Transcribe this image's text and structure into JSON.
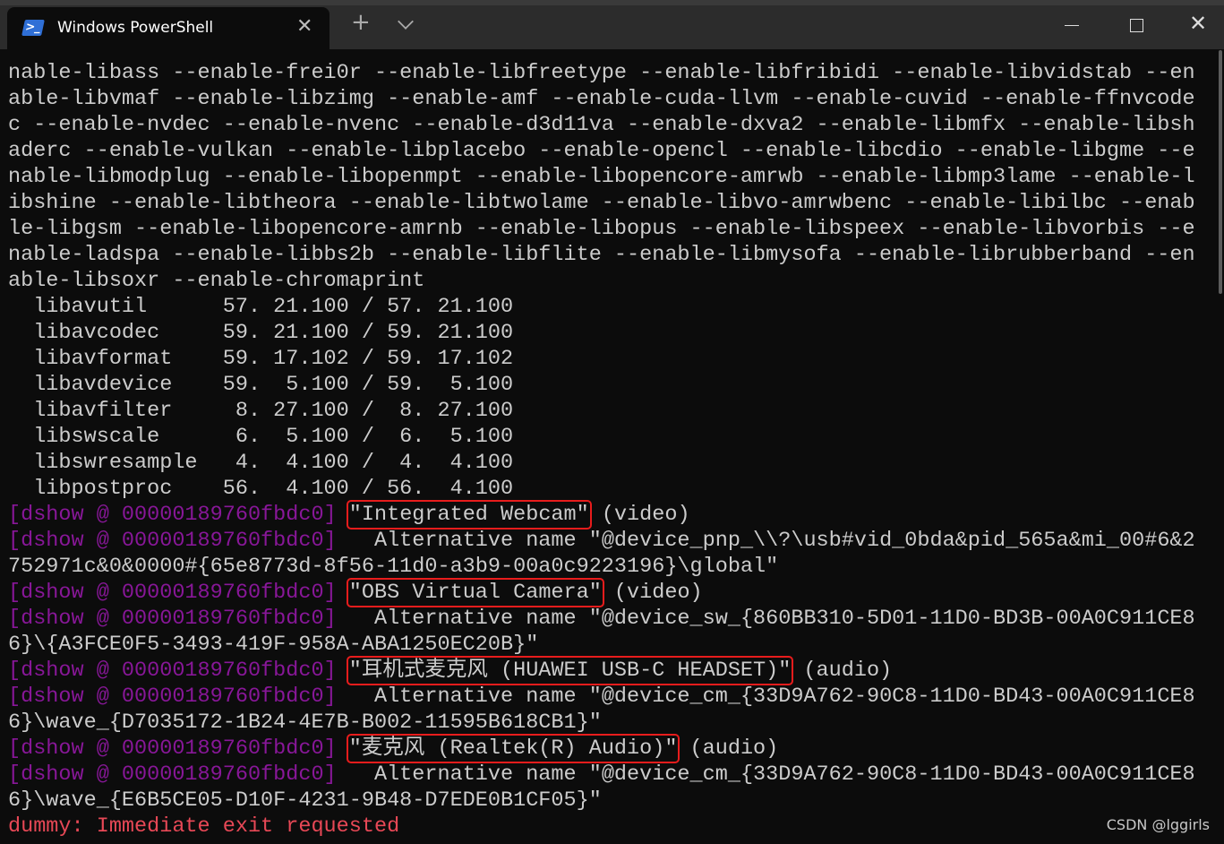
{
  "window": {
    "tab_title": "Windows PowerShell",
    "icon": "powershell-icon",
    "controls": [
      "minimize-icon",
      "maximize-icon",
      "close-icon"
    ]
  },
  "colors": {
    "text": "#cccccc",
    "dshow": "#881798",
    "error": "#e74856",
    "highlight_box": "#e81c1c"
  },
  "terminal": {
    "config_lines": [
      "nable-libass --enable-frei0r --enable-libfreetype --enable-libfribidi --enable-libvidstab --en",
      "able-libvmaf --enable-libzimg --enable-amf --enable-cuda-llvm --enable-cuvid --enable-ffnvcode",
      "c --enable-nvdec --enable-nvenc --enable-d3d11va --enable-dxva2 --enable-libmfx --enable-libsh",
      "aderc --enable-vulkan --enable-libplacebo --enable-opencl --enable-libcdio --enable-libgme --e",
      "nable-libmodplug --enable-libopenmpt --enable-libopencore-amrwb --enable-libmp3lame --enable-l",
      "ibshine --enable-libtheora --enable-libtwolame --enable-libvo-amrwbenc --enable-libilbc --enab",
      "le-libgsm --enable-libopencore-amrnb --enable-libopus --enable-libspeex --enable-libvorbis --e",
      "nable-ladspa --enable-libbs2b --enable-libflite --enable-libmysofa --enable-librubberband --en",
      "able-libsoxr --enable-chromaprint"
    ],
    "lib_lines": [
      "  libavutil      57. 21.100 / 57. 21.100",
      "  libavcodec     59. 21.100 / 59. 21.100",
      "  libavformat    59. 17.102 / 59. 17.102",
      "  libavdevice    59.  5.100 / 59.  5.100",
      "  libavfilter     8. 27.100 /  8. 27.100",
      "  libswscale      6.  5.100 /  6.  5.100",
      "  libswresample   4.  4.100 /  4.  4.100",
      "  libpostproc    56.  4.100 / 56.  4.100"
    ],
    "prefix": "[dshow @ 00000189760fbdc0]",
    "devices": [
      {
        "name": "\"Integrated Webcam\"",
        "type": " (video)",
        "alt_label": "   Alternative name ",
        "alt_1": "\"@device_pnp_\\\\?\\usb#vid_0bda&pid_565a&mi_00#6&2",
        "alt_2": "752971c&0&0000#{65e8773d-8f56-11d0-a3b9-00a0c9223196}\\global\""
      },
      {
        "name": "\"OBS Virtual Camera\"",
        "type": " (video)",
        "alt_label": "   Alternative name ",
        "alt_1": "\"@device_sw_{860BB310-5D01-11D0-BD3B-00A0C911CE8",
        "alt_2": "6}\\{A3FCE0F5-3493-419F-958A-ABA1250EC20B}\""
      },
      {
        "name": "\"耳机式麦克风 (HUAWEI USB-C HEADSET)\"",
        "type": " (audio)",
        "alt_label": "   Alternative name ",
        "alt_1": "\"@device_cm_{33D9A762-90C8-11D0-BD43-00A0C911CE8",
        "alt_2": "6}\\wave_{D7035172-1B24-4E7B-B002-11595B618CB1}\""
      },
      {
        "name": "\"麦克风 (Realtek(R) Audio)\"",
        "type": " (audio)",
        "alt_label": "   Alternative name ",
        "alt_1": "\"@device_cm_{33D9A762-90C8-11D0-BD43-00A0C911CE8",
        "alt_2": "6}\\wave_{E6B5CE05-D10F-4231-9B48-D7EDE0B1CF05}\""
      }
    ],
    "error_line": "dummy: Immediate exit requested"
  },
  "watermark": "CSDN @lggirls"
}
